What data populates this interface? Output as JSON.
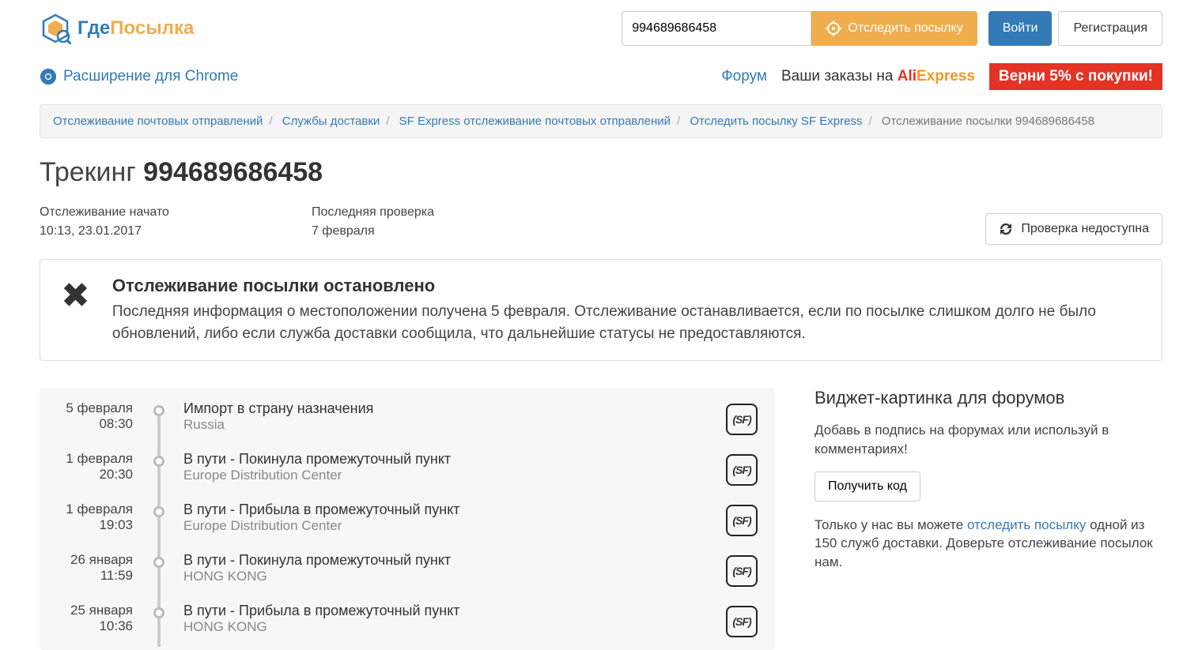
{
  "brand": {
    "part1": "Где",
    "part2": "Посылка"
  },
  "header": {
    "search_value": "994689686458",
    "track_btn": "Отследить посылку",
    "login": "Войти",
    "register": "Регистрация"
  },
  "subnav": {
    "chrome_ext": "Расширение для Chrome",
    "forum": "Форум",
    "ali_label": "Ваши заказы на ",
    "ali_brand1": "Ali",
    "ali_brand2": "Express",
    "cashback": "Верни 5% с покупки!"
  },
  "breadcrumb": {
    "a": "Отслеживание почтовых отправлений",
    "b": "Службы доставки",
    "c": "SF Express отслеживание почтовых отправлений",
    "d": "Отследить посылку SF Express",
    "e": "Отслеживание посылки 994689686458"
  },
  "title": {
    "prefix": "Трекинг ",
    "number": "994689686458"
  },
  "meta": {
    "started_label": "Отслеживание начато",
    "started_value": "10:13, 23.01.2017",
    "last_label": "Последняя проверка",
    "last_value": "7 февраля",
    "check_btn": "Проверка недоступна"
  },
  "alert": {
    "title": "Отслеживание посылки остановлено",
    "body": "Последняя информация о местоположении получена 5 февраля. Отслеживание останавливается, если по посылке слишком долго не было обновлений, либо если служба доставки сообщила, что дальнейшие статусы не предоставляются."
  },
  "events": [
    {
      "date": "5 февраля",
      "time": "08:30",
      "title": "Импорт в страну назначения",
      "loc": "Russia"
    },
    {
      "date": "1 февраля",
      "time": "20:30",
      "title": "В пути - Покинула промежуточный пункт",
      "loc": "Europe Distribution Center"
    },
    {
      "date": "1 февраля",
      "time": "19:03",
      "title": "В пути - Прибыла в промежуточный пункт",
      "loc": "Europe Distribution Center"
    },
    {
      "date": "26 января",
      "time": "11:59",
      "title": "В пути - Покинула промежуточный пункт",
      "loc": "HONG KONG"
    },
    {
      "date": "25 января",
      "time": "10:36",
      "title": "В пути - Прибыла в промежуточный пункт",
      "loc": "HONG KONG"
    }
  ],
  "sidebar": {
    "title": "Виджет-картинка для форумов",
    "desc": "Добавь в подпись на форумах или используй в комментариях!",
    "get_code": "Получить код",
    "foot_pre": "Только у нас вы можете ",
    "foot_link": "отследить посылку",
    "foot_post": " одной из 150 служб доставки. Доверьте отслеживание посылок нам."
  },
  "carrier_badge": "SF"
}
